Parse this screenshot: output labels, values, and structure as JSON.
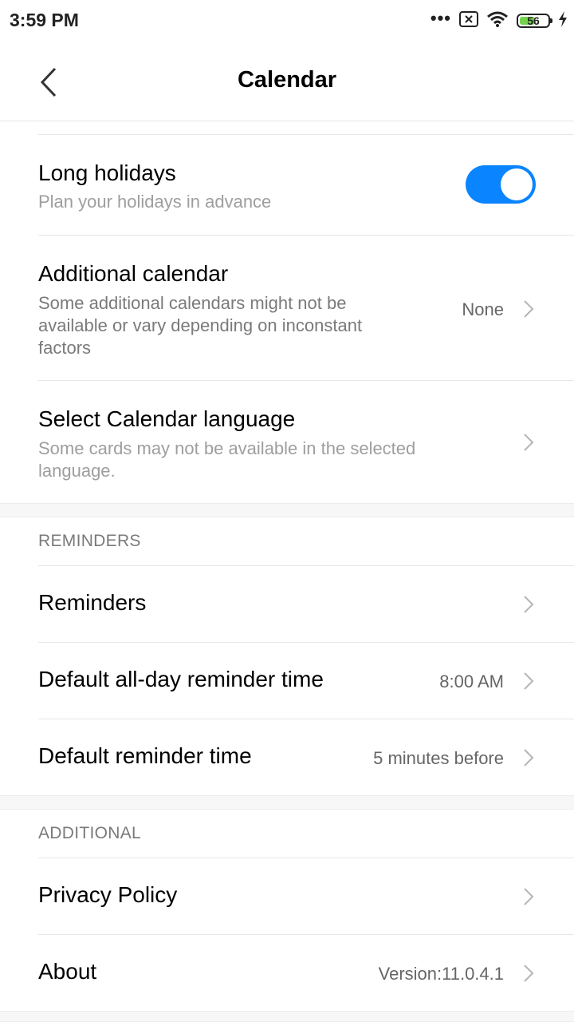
{
  "status_bar": {
    "time": "3:59 PM",
    "battery": "56",
    "battery_level": 0.56,
    "icons": [
      "more-dots-icon",
      "sim-off-icon",
      "wifi-icon",
      "battery-icon",
      "charging-icon"
    ]
  },
  "app_bar": {
    "title": "Calendar"
  },
  "settings": {
    "long_holidays": {
      "title": "Long holidays",
      "subtitle": "Plan your holidays in advance",
      "enabled": true
    },
    "additional_calendar": {
      "title": "Additional calendar",
      "subtitle_lines": [
        "Some additional calendars might not be",
        "available or vary depending on inconstant",
        "factors"
      ],
      "value": "None"
    },
    "calendar_language": {
      "title": "Select Calendar language",
      "subtitle_lines": [
        "Some cards may not be available in the selected",
        "language."
      ]
    }
  },
  "reminders_section": {
    "header": "REMINDERS",
    "items": [
      {
        "title": "Reminders",
        "value": ""
      },
      {
        "title": "Default all-day reminder time",
        "value": "8:00 AM"
      },
      {
        "title": "Default reminder time",
        "value": "5 minutes before"
      }
    ]
  },
  "additional_section": {
    "header": "ADDITIONAL",
    "items": [
      {
        "title": "Privacy Policy",
        "value": ""
      },
      {
        "title": "About",
        "value": "Version:11.0.4.1"
      }
    ]
  },
  "colors": {
    "accent": "#0a84ff",
    "battery_fill": "#74d14c"
  }
}
